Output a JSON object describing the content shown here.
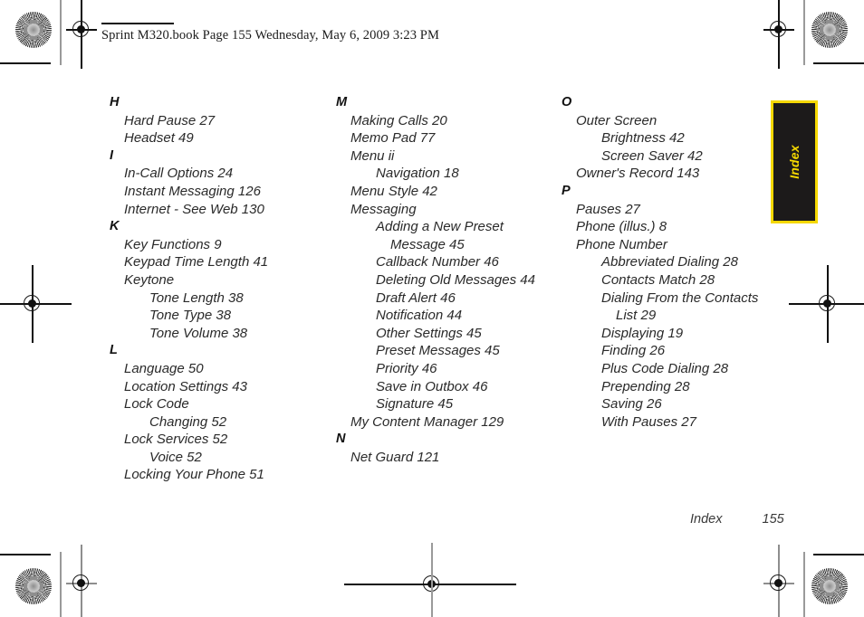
{
  "header": {
    "text": "Sprint M320.book  Page 155  Wednesday, May 6, 2009  3:23 PM"
  },
  "side_tab": {
    "label": "Index",
    "background_color": "#1c1a1a",
    "border_color": "#f5d800",
    "text_color": "#f5d800"
  },
  "footer": {
    "section": "Index",
    "page_number": "155"
  },
  "index": {
    "columns": [
      {
        "groups": [
          {
            "letter": "H",
            "entries": [
              {
                "text": "Hard Pause 27",
                "level": 1
              },
              {
                "text": "Headset 49",
                "level": 1
              }
            ]
          },
          {
            "letter": "I",
            "entries": [
              {
                "text": "In-Call Options 24",
                "level": 1
              },
              {
                "text": "Instant Messaging 126",
                "level": 1
              },
              {
                "text": "Internet - See Web 130",
                "level": 1
              }
            ]
          },
          {
            "letter": "K",
            "entries": [
              {
                "text": "Key Functions 9",
                "level": 1
              },
              {
                "text": "Keypad Time Length 41",
                "level": 1
              },
              {
                "text": "Keytone",
                "level": 1
              },
              {
                "text": "Tone Length 38",
                "level": 2
              },
              {
                "text": "Tone Type 38",
                "level": 2
              },
              {
                "text": "Tone Volume 38",
                "level": 2
              }
            ]
          },
          {
            "letter": "L",
            "entries": [
              {
                "text": "Language 50",
                "level": 1
              },
              {
                "text": "Location Settings 43",
                "level": 1
              },
              {
                "text": "Lock Code",
                "level": 1
              },
              {
                "text": "Changing 52",
                "level": 2
              },
              {
                "text": "Lock Services 52",
                "level": 1
              },
              {
                "text": "Voice 52",
                "level": 2
              },
              {
                "text": "Locking Your Phone 51",
                "level": 1
              }
            ]
          }
        ]
      },
      {
        "groups": [
          {
            "letter": "M",
            "entries": [
              {
                "text": "Making Calls 20",
                "level": 1
              },
              {
                "text": "Memo Pad 77",
                "level": 1
              },
              {
                "text": "Menu ii",
                "level": 1
              },
              {
                "text": "Navigation 18",
                "level": 2
              },
              {
                "text": "Menu Style 42",
                "level": 1
              },
              {
                "text": "Messaging",
                "level": 1
              },
              {
                "text": "Adding a New Preset",
                "level": 2
              },
              {
                "text": "Message 45",
                "level": 3
              },
              {
                "text": "Callback Number 46",
                "level": 2
              },
              {
                "text": "Deleting Old Messages 44",
                "level": 2
              },
              {
                "text": "Draft Alert 46",
                "level": 2
              },
              {
                "text": "Notification 44",
                "level": 2
              },
              {
                "text": "Other Settings 45",
                "level": 2
              },
              {
                "text": "Preset Messages 45",
                "level": 2
              },
              {
                "text": "Priority 46",
                "level": 2
              },
              {
                "text": "Save in Outbox 46",
                "level": 2
              },
              {
                "text": "Signature 45",
                "level": 2
              },
              {
                "text": "My Content Manager 129",
                "level": 1
              }
            ]
          },
          {
            "letter": "N",
            "entries": [
              {
                "text": "Net Guard 121",
                "level": 1
              }
            ]
          }
        ]
      },
      {
        "groups": [
          {
            "letter": "O",
            "entries": [
              {
                "text": "Outer Screen",
                "level": 1
              },
              {
                "text": "Brightness 42",
                "level": 2
              },
              {
                "text": "Screen Saver 42",
                "level": 2
              },
              {
                "text": "Owner's Record 143",
                "level": 1
              }
            ]
          },
          {
            "letter": "P",
            "entries": [
              {
                "text": "Pauses 27",
                "level": 1
              },
              {
                "text": "Phone (illus.) 8",
                "level": 1
              },
              {
                "text": "Phone Number",
                "level": 1
              },
              {
                "text": "Abbreviated Dialing 28",
                "level": 2
              },
              {
                "text": "Contacts Match 28",
                "level": 2
              },
              {
                "text": "Dialing From the Contacts",
                "level": 2
              },
              {
                "text": "List 29",
                "level": 3
              },
              {
                "text": "Displaying 19",
                "level": 2
              },
              {
                "text": "Finding 26",
                "level": 2
              },
              {
                "text": "Plus Code Dialing 28",
                "level": 2
              },
              {
                "text": "Prepending 28",
                "level": 2
              },
              {
                "text": "Saving 26",
                "level": 2
              },
              {
                "text": "With Pauses 27",
                "level": 2
              }
            ]
          }
        ]
      }
    ]
  }
}
